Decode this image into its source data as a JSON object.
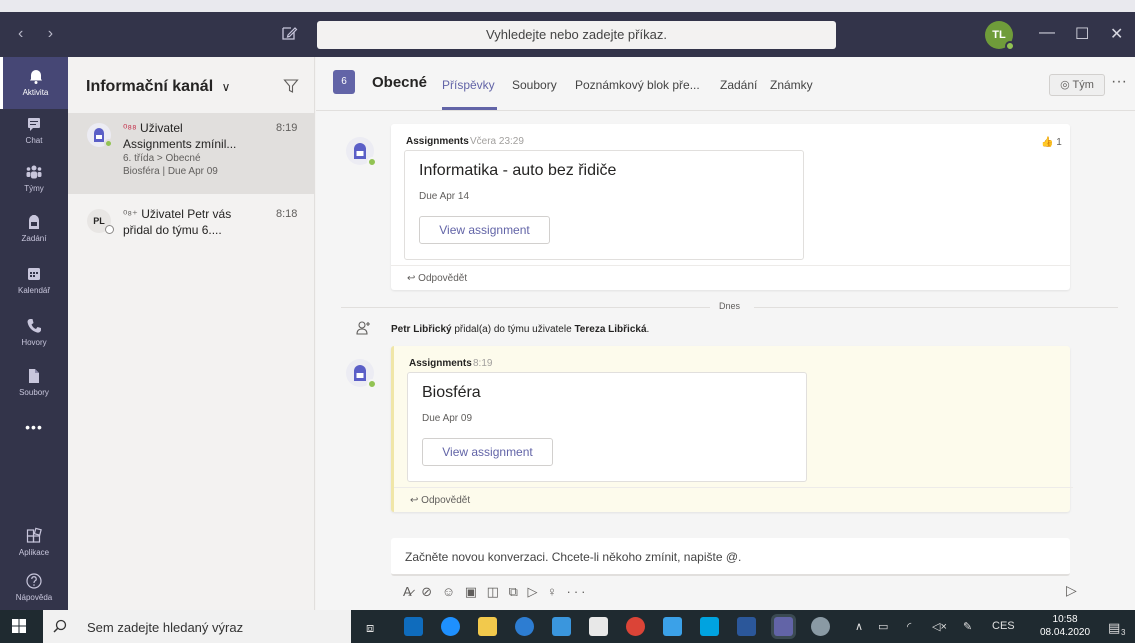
{
  "titlebar": {
    "search_placeholder": "Vyhledejte nebo zadejte příkaz.",
    "avatar_initials": "TL",
    "win_min": "—",
    "win_max": "☐",
    "win_close": "✕"
  },
  "rail": {
    "items": [
      {
        "label": "Aktivita",
        "icon": "bell-icon"
      },
      {
        "label": "Chat",
        "icon": "chat-icon"
      },
      {
        "label": "Týmy",
        "icon": "teams-icon"
      },
      {
        "label": "Zadání",
        "icon": "assignments-icon"
      },
      {
        "label": "Kalendář",
        "icon": "calendar-icon"
      },
      {
        "label": "Hovory",
        "icon": "phone-icon"
      },
      {
        "label": "Soubory",
        "icon": "files-icon"
      },
      {
        "label": "Aplikace",
        "icon": "apps-icon"
      },
      {
        "label": "Nápověda",
        "icon": "help-icon"
      }
    ],
    "more": "•••"
  },
  "feed": {
    "title": "Informační kanál",
    "items": [
      {
        "line1": "Uživatel",
        "line2": "Assignments zmínil...",
        "line3": "6. třída > Obecné",
        "line4": "Biosféra | Due Apr 09",
        "time": "8:19"
      },
      {
        "avatar": "PL",
        "line1": "Uživatel Petr vás",
        "line2": "přidal do týmu 6....",
        "time": "8:18"
      }
    ]
  },
  "channel": {
    "badge": "6",
    "name": "Obecné",
    "tabs": [
      "Příspěvky",
      "Soubory",
      "Poznámkový blok pře...",
      "Zadání",
      "Známky"
    ],
    "team_button": "Tým",
    "more": "···",
    "posts": [
      {
        "author": "Assignments",
        "time": "Včera 23:29",
        "title": "Informatika - auto bez řidiče",
        "due": "Due Apr 14",
        "button": "View assignment",
        "reply": "Odpovědět",
        "likes": "1"
      },
      {
        "author": "Assignments",
        "time": "8:19",
        "title": "Biosféra",
        "due": "Due Apr 09",
        "button": "View assignment",
        "reply": "Odpovědět"
      }
    ],
    "divider_label": "Dnes",
    "system_message": {
      "actor": "Petr Libřický",
      "action": " přidal(a) do týmu uživatele ",
      "target": "Tereza Libřická",
      "end": "."
    },
    "compose_placeholder": "Začněte novou konverzaci. Chcete-li někoho zmínit, napište @."
  },
  "taskbar": {
    "search_text": "Sem zadejte hledaný výraz",
    "lang": "CES",
    "time": "10:58",
    "date": "08.04.2020",
    "notifications": "3"
  }
}
